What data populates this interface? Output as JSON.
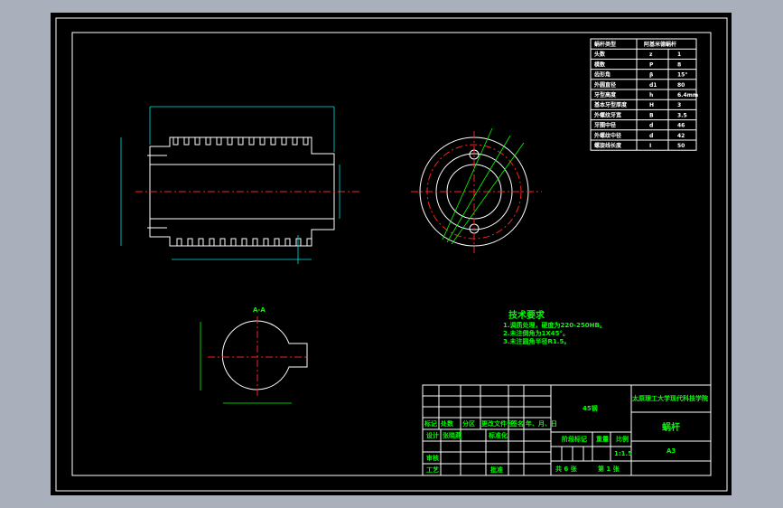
{
  "colors": {
    "background": "#000000",
    "outline": "#ffffff",
    "centerline": "#ff2020",
    "dimension": "#00e0e0",
    "text": "#00ff00"
  },
  "param_table": {
    "header": [
      "蜗杆类型",
      "阿基米德蜗杆"
    ],
    "rows": [
      [
        "头数",
        "z",
        "1"
      ],
      [
        "模数",
        "P",
        "8"
      ],
      [
        "齿形角",
        "β",
        "15°"
      ],
      [
        "外圆直径",
        "d1",
        "80"
      ],
      [
        "牙型高度",
        "h",
        "6.4mm"
      ],
      [
        "基本牙型厚度",
        "H",
        "3"
      ],
      [
        "外螺纹牙宽",
        "B",
        "3.5"
      ],
      [
        "牙圈中径",
        "d",
        "46"
      ],
      [
        "外螺纹中径",
        "d",
        "42"
      ],
      [
        "螺旋线长度",
        "I",
        "50"
      ]
    ]
  },
  "section_label": "A-A",
  "tech_req": {
    "title": "技术要求",
    "items": [
      "1.调质处理，硬度为220-250HB。",
      "2.未注倒角为1X45°。",
      "3.未注圆角半径R1.5。"
    ]
  },
  "title_block": {
    "school": "太原理工大学现代科技学院",
    "material": "45钢",
    "part_name": "蜗杆",
    "drawing_no": "A3",
    "rev_headers": [
      "标记",
      "处数",
      "分区",
      "更改文件号",
      "签名",
      "年、月、日"
    ],
    "design": "设计",
    "designer": "张晓燕",
    "standard": "标准化",
    "review": "审核",
    "process": "工艺",
    "approve": "批准",
    "stage": "阶段标记",
    "weight": "重量",
    "scale_label": "比例",
    "scale": "1:1.5",
    "total": "共 6 张",
    "sheet": "第 1 张"
  }
}
